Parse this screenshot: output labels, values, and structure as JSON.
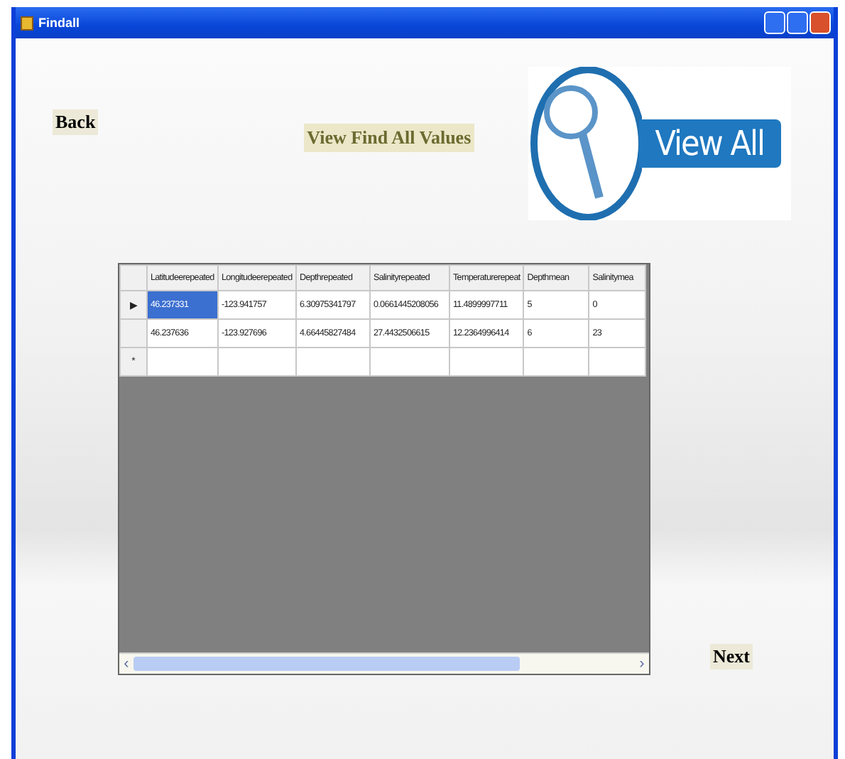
{
  "window": {
    "title": "Findall"
  },
  "back_button": {
    "label": "Back"
  },
  "heading": "View Find All Values",
  "view_all_button": {
    "label": "View All"
  },
  "table": {
    "columns": [
      "Latitudeerepeated",
      "Longitudeerepeated",
      "Depthrepeated",
      "Salinityrepeated",
      "Temperaturerepeat",
      "Depthmean",
      "Salinitymea"
    ],
    "rows": [
      {
        "marker": "▶",
        "cells": [
          {
            "text": "46.237331",
            "selected": true
          },
          {
            "text": "-123.941757",
            "selected": false
          },
          {
            "text": "6.30975341797",
            "selected": false
          },
          {
            "text": "0.0661445208056",
            "selected": false
          },
          {
            "text": "11.4899997711",
            "selected": false
          },
          {
            "text": "5",
            "selected": false
          },
          {
            "text": "0",
            "selected": false
          }
        ]
      },
      {
        "marker": "",
        "cells": [
          {
            "text": "46.237636",
            "selected": false
          },
          {
            "text": "-123.927696",
            "selected": false
          },
          {
            "text": "4.66445827484",
            "selected": false
          },
          {
            "text": "27.4432506615",
            "selected": false
          },
          {
            "text": "12.2364996414",
            "selected": false
          },
          {
            "text": "6",
            "selected": false
          },
          {
            "text": "23",
            "selected": false
          }
        ]
      }
    ],
    "new_row": {
      "marker": "*"
    },
    "scroll_left": "‹",
    "scroll_right": "›"
  },
  "next_button": {
    "label": "Next"
  }
}
